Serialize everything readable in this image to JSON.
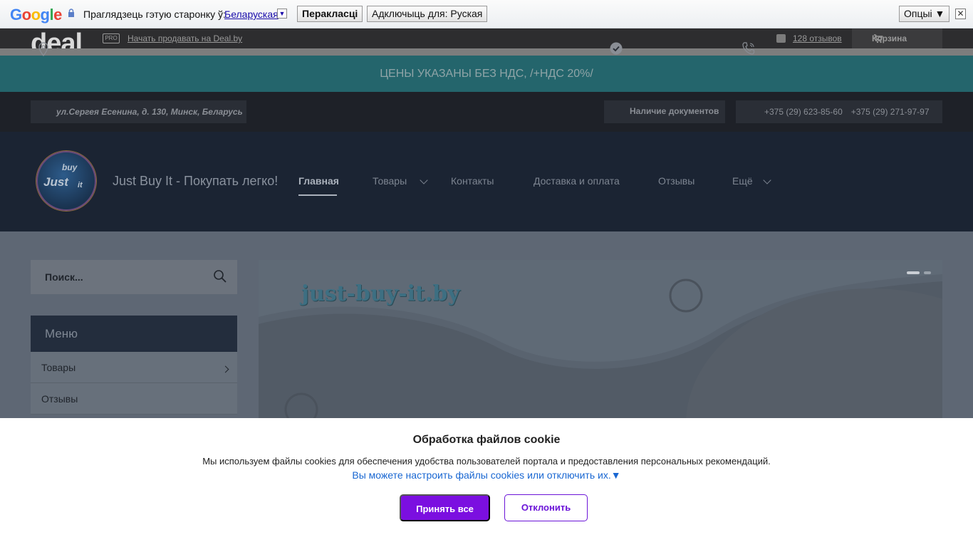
{
  "translate_bar": {
    "logo": "Google",
    "prompt": "Праглядзець гэтую старонку ў:",
    "language": "Беларуская",
    "translate_button": "Перакласці",
    "disable_button": "Адключыць для: Руская",
    "options_button": "Опцыі ▼",
    "close": "✕"
  },
  "topbar": {
    "logo": "deal",
    "pro_badge": "PRO",
    "sell_link": "Начать продавать на Deal.by",
    "reviews_link": "128 отзывов",
    "cart": "Корзина"
  },
  "banner": {
    "text": "ЦЕНЫ УКАЗАНЫ БЕЗ НДС, /+НДС 20%/"
  },
  "info_bar": {
    "address": "ул.Сергея Есенина, д. 130, Минск, Беларусь",
    "documents": "Наличие документов",
    "phone1": "+375 (29) 623-85-60",
    "phone2": "+375 (29) 271-97-97"
  },
  "header": {
    "logo_line1": "buy",
    "logo_line2": "Just",
    "logo_line3": "it",
    "site_name": "Just Buy It - Покупать легко!",
    "nav": {
      "home": "Главная",
      "products": "Товары",
      "contacts": "Контакты",
      "delivery": "Доставка и оплата",
      "reviews": "Отзывы",
      "more": "Ещё"
    }
  },
  "sidebar": {
    "search_placeholder": "Поиск...",
    "menu_title": "Меню",
    "items": [
      "Товары",
      "Отзывы"
    ]
  },
  "slider": {
    "logo_text": "just-buy-it.by",
    "active_slide": 1,
    "slide_count": 2
  },
  "cookie": {
    "title": "Обработка файлов cookie",
    "text": "Мы используем файлы cookies для обеспечения удобства пользователей портала и предоставления персональных рекомендаций.",
    "settings_link": "Вы можете настроить файлы cookies или отключить их.▼",
    "accept": "Принять все",
    "reject": "Отклонить"
  },
  "colors": {
    "accept_button": "#7b0fe0",
    "link": "#1967d2",
    "banner": "#24656c"
  }
}
